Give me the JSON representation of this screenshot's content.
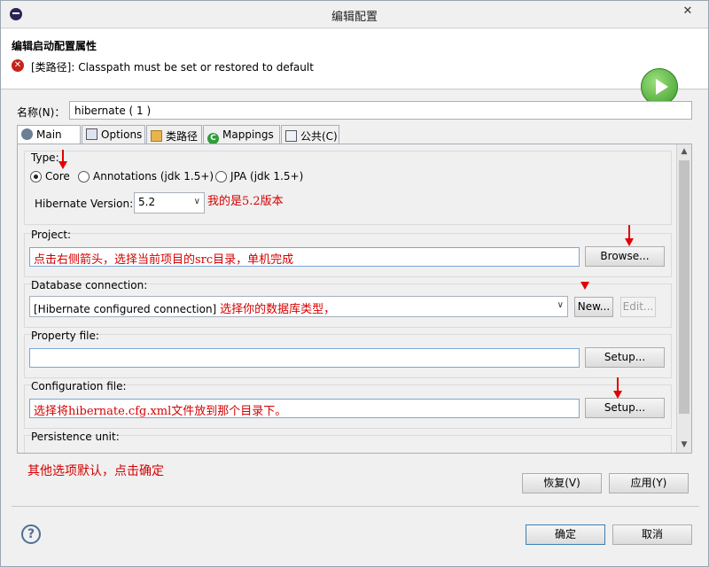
{
  "window": {
    "title": "编辑配置",
    "close_label": "✕"
  },
  "header": {
    "title": "编辑启动配置属性",
    "error_message": "[类路径]: Classpath must be set or restored to default"
  },
  "name_field": {
    "label": "名称(N)：",
    "value": "hibernate ( 1 )"
  },
  "tabs": [
    {
      "label": "Main",
      "active": true,
      "icon": "main-tab-icon"
    },
    {
      "label": "Options",
      "active": false,
      "icon": "options-tab-icon"
    },
    {
      "label": "类路径",
      "active": false,
      "icon": "classpath-tab-icon"
    },
    {
      "label": "Mappings",
      "active": false,
      "icon": "mappings-tab-icon"
    },
    {
      "label": "公共(C)",
      "active": false,
      "icon": "common-tab-icon"
    }
  ],
  "type_group": {
    "label": "Type:",
    "options": [
      {
        "label": "Core",
        "selected": true
      },
      {
        "label": "Annotations (jdk 1.5+)",
        "selected": false
      },
      {
        "label": "JPA (jdk 1.5+)",
        "selected": false
      }
    ],
    "version_label": "Hibernate Version:",
    "version_value": "5.2",
    "annotation": "我的是5.2版本"
  },
  "project_group": {
    "label": "Project:",
    "annotation": "点击右侧箭头，选择当前项目的src目录，单机完成",
    "browse_label": "Browse..."
  },
  "db_group": {
    "label": "Database connection:",
    "value": "[Hibernate configured connection]",
    "annotation": "选择你的数据库类型，",
    "new_label": "New...",
    "edit_label": "Edit..."
  },
  "property_group": {
    "label": "Property file:",
    "setup_label": "Setup..."
  },
  "config_group": {
    "label": "Configuration file:",
    "annotation": "选择将hibernate.cfg.xml文件放到那个目录下。",
    "setup_label": "Setup..."
  },
  "persistence_group": {
    "label": "Persistence unit:"
  },
  "bottom_annotation": "其他选项默认，点击确定",
  "actions": {
    "revert_label": "恢复(V)",
    "apply_label": "应用(Y)"
  },
  "footer": {
    "ok_label": "确定",
    "cancel_label": "取消",
    "help_label": "?"
  },
  "colors": {
    "annotation_red": "#d40000",
    "arrow_red": "#e20000"
  }
}
